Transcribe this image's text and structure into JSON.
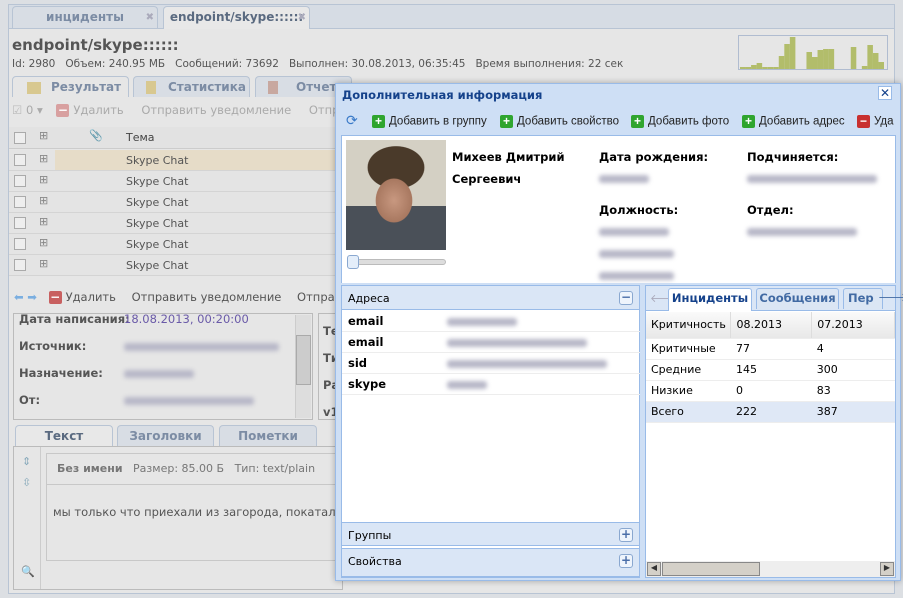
{
  "top_tabs": [
    {
      "label": "инциденты"
    },
    {
      "label": "endpoint/skype::::::"
    }
  ],
  "header": {
    "title": "endpoint/skype::::::",
    "info": "Id: 2980   Объем: 240.95 МБ   Сообщений: 73692   Выполнен: 30.08.2013, 06:35:45   Время выполнения: 22 сек"
  },
  "sparkline": {
    "color": "#b2bd6b",
    "values": [
      2,
      2,
      4,
      6,
      2,
      2,
      2,
      13,
      25,
      32,
      0,
      0,
      17,
      12,
      19,
      20,
      20,
      0,
      0,
      0,
      22,
      0,
      3,
      24,
      16,
      7
    ]
  },
  "result_tabs": [
    {
      "label": "Результат"
    },
    {
      "label": "Статистика"
    },
    {
      "label": "Отчет"
    }
  ],
  "toolbar": {
    "count": "0",
    "delete": "Удалить",
    "notify": "Отправить уведомление",
    "send": "Отправить"
  },
  "grid": {
    "col_subject": "Тема",
    "rows": [
      "Skype Chat",
      "Skype Chat",
      "Skype Chat",
      "Skype Chat",
      "Skype Chat",
      "Skype Chat"
    ]
  },
  "toolbar2": {
    "delete": "Удалить",
    "notify": "Отправить уведомление",
    "send": "Отправит"
  },
  "details": {
    "date_label": "Дата написания:",
    "date_value": "18.08.2013, 00:20:00",
    "source_label": "Источник:",
    "dest_label": "Назначение:",
    "from_label": "От:",
    "side": [
      "Те",
      "Ти",
      "Ра",
      "v1"
    ]
  },
  "detail_tabs": [
    {
      "label": "Текст"
    },
    {
      "label": "Заголовки"
    },
    {
      "label": "Пометки"
    }
  ],
  "attachment": {
    "name": "Без имени",
    "size": "Размер: 85.00 Б",
    "type": "Тип: text/plain",
    "text": "мы только что приехали из загорода, покатались"
  },
  "dialog": {
    "title": "Дополнительная информация",
    "toolbar": {
      "add_group": "Добавить в группу",
      "add_property": "Добавить свойство",
      "add_photo": "Добавить фото",
      "add_address": "Добавить адрес",
      "delete": "Уда"
    },
    "person": {
      "name1": "Михеев Дмитрий",
      "name2": "Сергеевич",
      "birth_label": "Дата рождения:",
      "manager_label": "Подчиняется:",
      "position_label": "Должность:",
      "dept_label": "Отдел:"
    },
    "addresses": {
      "title": "Адреса",
      "items": [
        {
          "key": "email"
        },
        {
          "key": "email"
        },
        {
          "key": "sid"
        },
        {
          "key": "skype"
        }
      ]
    },
    "groups_title": "Группы",
    "props_title": "Свойства",
    "tabs": [
      {
        "label": "Инциденты"
      },
      {
        "label": "Сообщения"
      },
      {
        "label": "Пер"
      }
    ],
    "stats": {
      "headers": [
        "Критичность",
        "08.2013",
        "07.2013"
      ],
      "rows": [
        [
          "Критичные",
          "77",
          "4"
        ],
        [
          "Средние",
          "145",
          "300"
        ],
        [
          "Низкие",
          "0",
          "83"
        ],
        [
          "Всего",
          "222",
          "387"
        ]
      ]
    }
  }
}
